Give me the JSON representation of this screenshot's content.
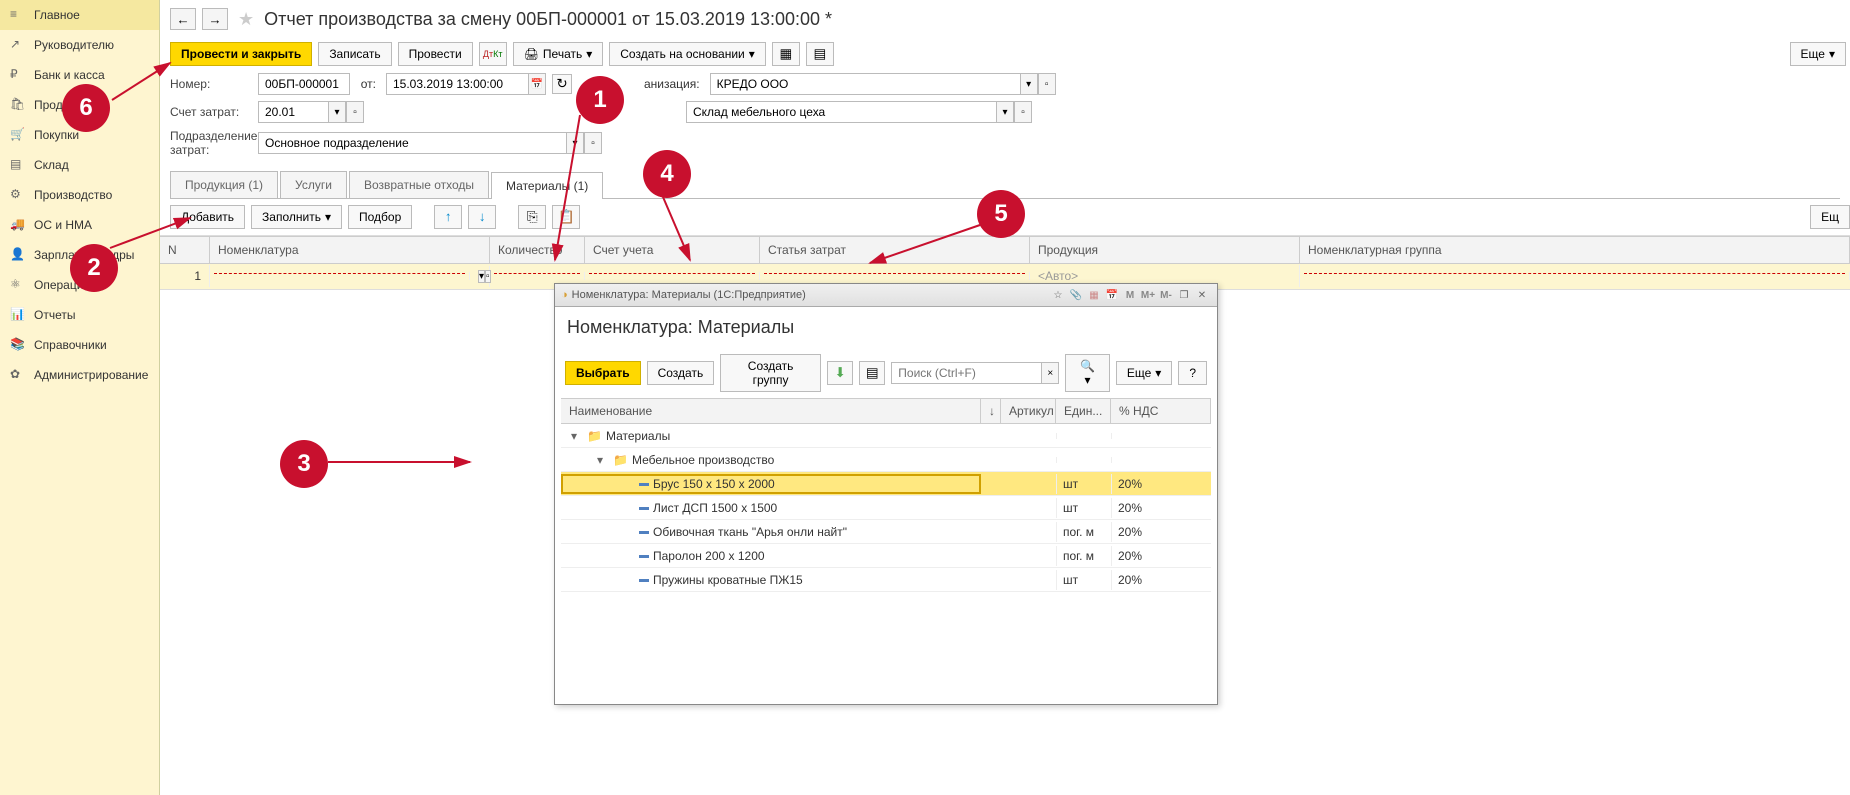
{
  "sidebar": {
    "items": [
      {
        "label": "Главное",
        "icon": "≡"
      },
      {
        "label": "Руководителю",
        "icon": "↗"
      },
      {
        "label": "Банк и касса",
        "icon": "₽"
      },
      {
        "label": "Продажи",
        "icon": "🛍"
      },
      {
        "label": "Покупки",
        "icon": "🛒"
      },
      {
        "label": "Склад",
        "icon": "▤"
      },
      {
        "label": "Производство",
        "icon": "⚙"
      },
      {
        "label": "ОС и НМА",
        "icon": "🚚"
      },
      {
        "label": "Зарплата и кадры",
        "icon": "👤"
      },
      {
        "label": "Операции",
        "icon": "⚛"
      },
      {
        "label": "Отчеты",
        "icon": "📊"
      },
      {
        "label": "Справочники",
        "icon": "📚"
      },
      {
        "label": "Администрирование",
        "icon": "✿"
      }
    ]
  },
  "header": {
    "title": "Отчет производства за смену 00БП-000001 от 15.03.2019 13:00:00 *"
  },
  "toolbar": {
    "post_close": "Провести и закрыть",
    "write": "Записать",
    "post": "Провести",
    "print": "Печать",
    "create_basedon": "Создать на основании",
    "more": "Еще"
  },
  "form": {
    "number_label": "Номер:",
    "number_value": "00БП-000001",
    "from_label": "от:",
    "date_value": "15.03.2019 13:00:00",
    "org_label": "анизация:",
    "org_value": "КРЕДО ООО",
    "cost_account_label": "Счет затрат:",
    "cost_account_value": "20.01",
    "warehouse_value": "Склад мебельного цеха",
    "subdivision_label": "Подразделение затрат:",
    "subdivision_value": "Основное подразделение"
  },
  "tabs": [
    {
      "label": "Продукция (1)"
    },
    {
      "label": "Услуги"
    },
    {
      "label": "Возвратные отходы"
    },
    {
      "label": "Материалы (1)"
    }
  ],
  "subtoolbar": {
    "add": "Добавить",
    "fill": "Заполнить",
    "select": "Подбор",
    "more": "Ещ"
  },
  "table": {
    "columns": {
      "n": "N",
      "nomenclature": "Номенклатура",
      "qty": "Количество",
      "account": "Счет учета",
      "cost_item": "Статья затрат",
      "product": "Продукция",
      "nomgroup": "Номенклатурная группа"
    },
    "rows": [
      {
        "n": "1",
        "product": "<Авто>"
      }
    ]
  },
  "modal": {
    "titlebar": "Номенклатура: Материалы  (1С:Предприятие)",
    "header": "Номенклатура: Материалы",
    "select_btn": "Выбрать",
    "create_btn": "Создать",
    "create_group_btn": "Создать группу",
    "search_placeholder": "Поиск (Ctrl+F)",
    "more": "Еще",
    "help": "?",
    "columns": {
      "name": "Наименование",
      "sort": "↓",
      "article": "Артикул",
      "unit": "Един...",
      "vat": "% НДС"
    },
    "tree": [
      {
        "type": "folder",
        "level": 0,
        "name": "Материалы",
        "expanded": true
      },
      {
        "type": "folder",
        "level": 1,
        "name": "Мебельное производство",
        "expanded": true
      },
      {
        "type": "item",
        "level": 2,
        "name": "Брус 150 х 150 х 2000",
        "unit": "шт",
        "vat": "20%",
        "selected": true
      },
      {
        "type": "item",
        "level": 2,
        "name": "Лист ДСП 1500 х 1500",
        "unit": "шт",
        "vat": "20%"
      },
      {
        "type": "item",
        "level": 2,
        "name": "Обивочная ткань \"Арья онли найт\"",
        "unit": "пог. м",
        "vat": "20%"
      },
      {
        "type": "item",
        "level": 2,
        "name": "Паролон 200 х 1200",
        "unit": "пог. м",
        "vat": "20%"
      },
      {
        "type": "item",
        "level": 2,
        "name": "Пружины кроватные ПЖ15",
        "unit": "шт",
        "vat": "20%"
      }
    ]
  },
  "annotations": {
    "1": "1",
    "2": "2",
    "3": "3",
    "4": "4",
    "5": "5",
    "6": "6"
  }
}
